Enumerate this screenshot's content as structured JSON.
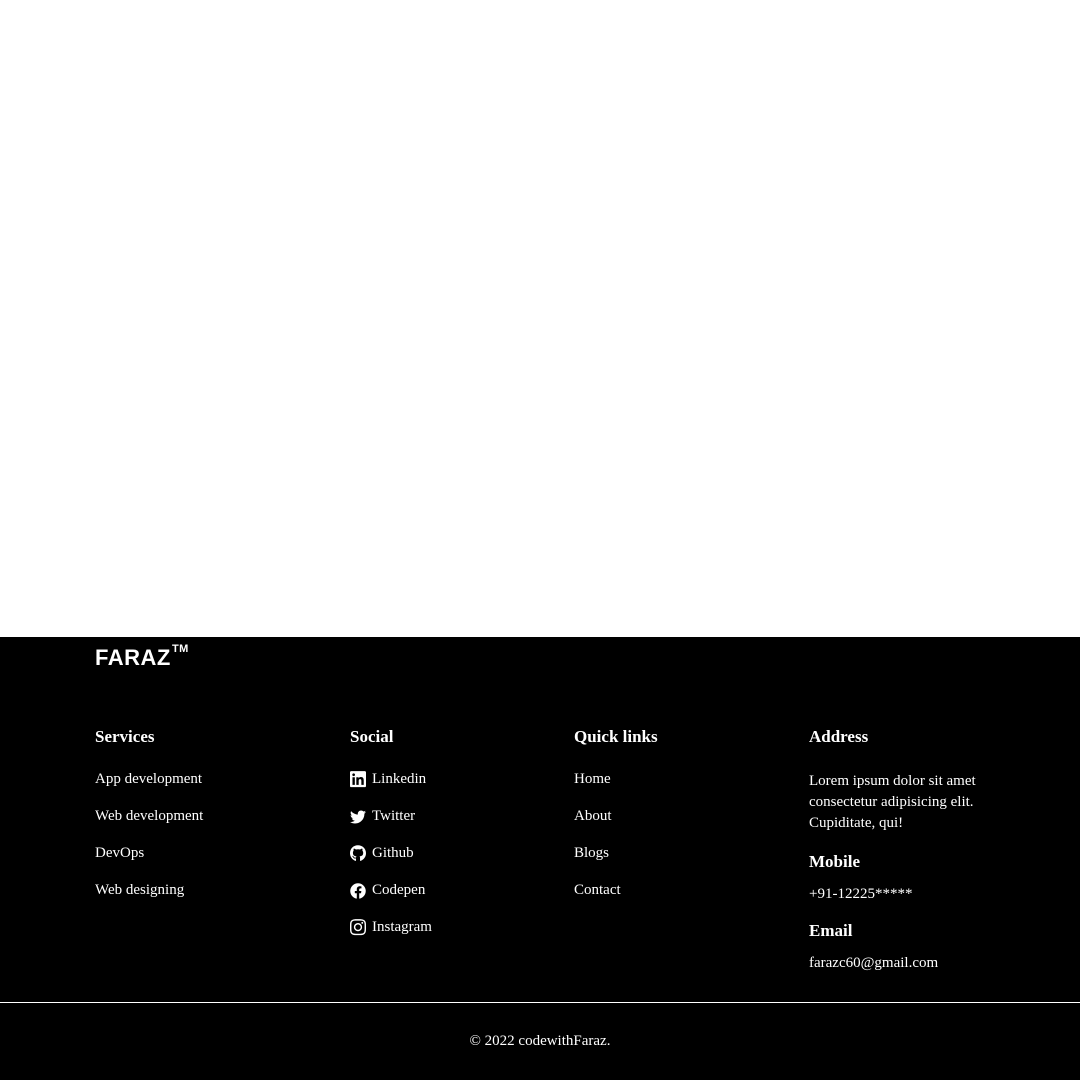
{
  "brand": "FARAZ",
  "brand_tm": "TM",
  "columns": {
    "services": {
      "heading": "Services",
      "items": [
        "App development",
        "Web development",
        "DevOps",
        "Web designing"
      ]
    },
    "social": {
      "heading": "Social",
      "items": [
        "Linkedin",
        "Twitter",
        "Github",
        "Codepen",
        "Instagram"
      ]
    },
    "quicklinks": {
      "heading": "Quick links",
      "items": [
        "Home",
        "About",
        "Blogs",
        "Contact"
      ]
    },
    "address": {
      "heading": "Address",
      "text": "Lorem ipsum dolor sit amet consectetur adipisicing elit. Cupiditate, qui!",
      "mobile_heading": "Mobile",
      "mobile_value": "+91-12225*****",
      "email_heading": "Email",
      "email_value": "farazc60@gmail.com"
    }
  },
  "copyright": "© 2022 codewithFaraz."
}
